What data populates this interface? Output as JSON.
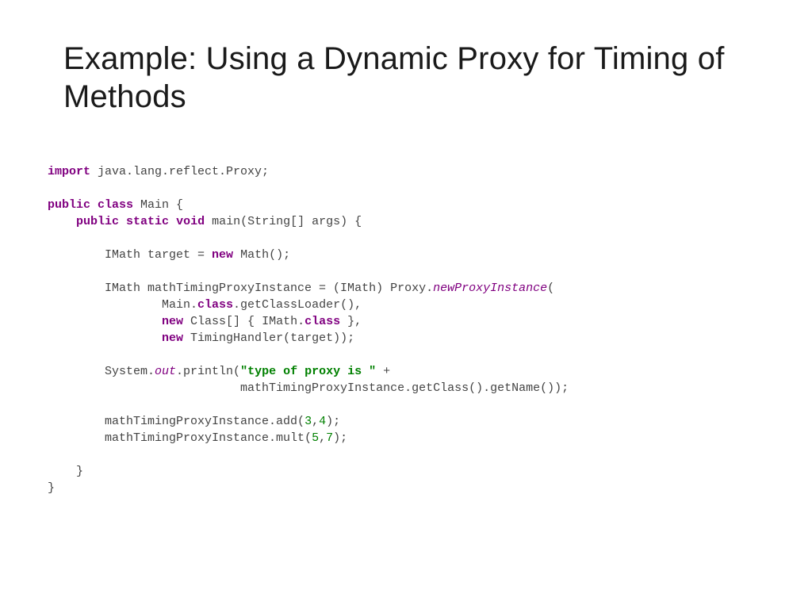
{
  "title": "Example: Using a Dynamic Proxy for Timing of Methods",
  "code": {
    "import_kw": "import",
    "import_pkg": " java.lang.reflect.Proxy;",
    "public_kw": "public",
    "class_kw": "class",
    "main_cls": " Main {",
    "static_kw": "static",
    "void_kw": "void",
    "main_sig": " main(String[] args) {",
    "new_kw": "new",
    "target_line_a": "        IMath target = ",
    "target_line_b": " Math();",
    "proxy_decl": "        IMath mathTimingProxyInstance = (IMath) Proxy.",
    "newproxy": "newProxyInstance",
    "paren": "(",
    "loader_a": "                Main.",
    "loader_cls": "class",
    "loader_b": ".getClassLoader(),",
    "clsarr_a": "                ",
    "clsarr_b": " Class[] { IMath.",
    "clsarr_c": " },",
    "handler_a": "                ",
    "handler_b": " TimingHandler(target));",
    "sysout_a": "        System.",
    "sysout_out": "out",
    "sysout_b": ".println(",
    "strlit": "\"type of proxy is \"",
    "sysout_c": " + ",
    "sysout_d": "                           mathTimingProxyInstance.getClass().getName());",
    "add_a": "        mathTimingProxyInstance.add(",
    "n3": "3",
    "comma": ",",
    "n4": "4",
    "close_call": ");",
    "mult_a": "        mathTimingProxyInstance.mult(",
    "n5": "5",
    "n7": "7",
    "brace_close1": "    }",
    "brace_close2": "}"
  }
}
